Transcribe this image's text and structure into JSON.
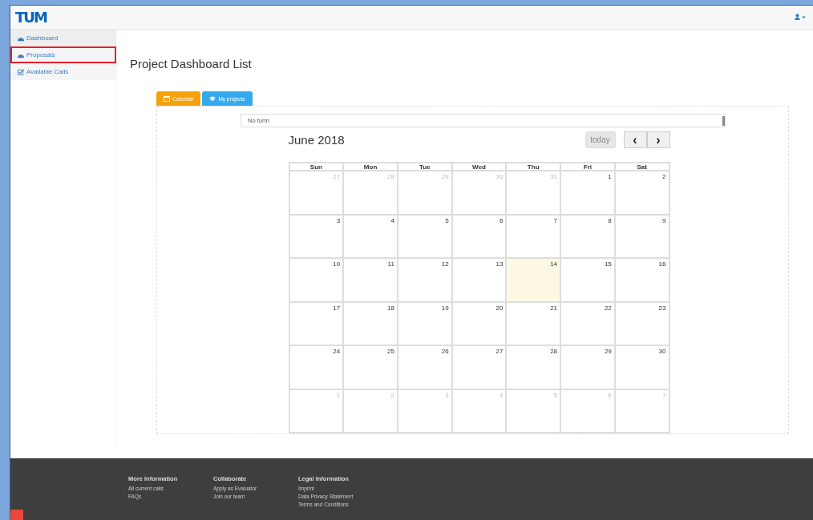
{
  "navbar": {
    "logo": "TUM"
  },
  "sidebar": {
    "items": [
      {
        "label": "Dashboard",
        "kind": "dashboard",
        "highlighted": false
      },
      {
        "label": "Proposals",
        "kind": "dashboard",
        "highlighted": true
      },
      {
        "label": "Available Calls",
        "kind": "check",
        "highlighted": false
      }
    ]
  },
  "page": {
    "title": "Project Dashboard List"
  },
  "tabs": [
    {
      "label": "Calendar",
      "kind": "calendar",
      "color": "#f5a20a"
    },
    {
      "label": "My projects",
      "kind": "cap",
      "color": "#33a9ee"
    }
  ],
  "form_select": {
    "value": "No form"
  },
  "calendar": {
    "title": "June 2018",
    "today_button": "today",
    "prev_button": "‹",
    "next_button": "›",
    "weekdays": [
      "Sun",
      "Mon",
      "Tue",
      "Wed",
      "Thu",
      "Fri",
      "Sat"
    ],
    "weeks": [
      [
        {
          "day": "27",
          "other_month": true,
          "today": false
        },
        {
          "day": "28",
          "other_month": true,
          "today": false
        },
        {
          "day": "29",
          "other_month": true,
          "today": false
        },
        {
          "day": "30",
          "other_month": true,
          "today": false
        },
        {
          "day": "31",
          "other_month": true,
          "today": false
        },
        {
          "day": "1",
          "other_month": false,
          "today": false
        },
        {
          "day": "2",
          "other_month": false,
          "today": false
        }
      ],
      [
        {
          "day": "3",
          "other_month": false,
          "today": false
        },
        {
          "day": "4",
          "other_month": false,
          "today": false
        },
        {
          "day": "5",
          "other_month": false,
          "today": false
        },
        {
          "day": "6",
          "other_month": false,
          "today": false
        },
        {
          "day": "7",
          "other_month": false,
          "today": false
        },
        {
          "day": "8",
          "other_month": false,
          "today": false
        },
        {
          "day": "9",
          "other_month": false,
          "today": false
        }
      ],
      [
        {
          "day": "10",
          "other_month": false,
          "today": false
        },
        {
          "day": "11",
          "other_month": false,
          "today": false
        },
        {
          "day": "12",
          "other_month": false,
          "today": false
        },
        {
          "day": "13",
          "other_month": false,
          "today": false
        },
        {
          "day": "14",
          "other_month": false,
          "today": true
        },
        {
          "day": "15",
          "other_month": false,
          "today": false
        },
        {
          "day": "16",
          "other_month": false,
          "today": false
        }
      ],
      [
        {
          "day": "17",
          "other_month": false,
          "today": false
        },
        {
          "day": "18",
          "other_month": false,
          "today": false
        },
        {
          "day": "19",
          "other_month": false,
          "today": false
        },
        {
          "day": "20",
          "other_month": false,
          "today": false
        },
        {
          "day": "21",
          "other_month": false,
          "today": false
        },
        {
          "day": "22",
          "other_month": false,
          "today": false
        },
        {
          "day": "23",
          "other_month": false,
          "today": false
        }
      ],
      [
        {
          "day": "24",
          "other_month": false,
          "today": false
        },
        {
          "day": "25",
          "other_month": false,
          "today": false
        },
        {
          "day": "26",
          "other_month": false,
          "today": false
        },
        {
          "day": "27",
          "other_month": false,
          "today": false
        },
        {
          "day": "28",
          "other_month": false,
          "today": false
        },
        {
          "day": "29",
          "other_month": false,
          "today": false
        },
        {
          "day": "30",
          "other_month": false,
          "today": false
        }
      ],
      [
        {
          "day": "1",
          "other_month": true,
          "today": false
        },
        {
          "day": "2",
          "other_month": true,
          "today": false
        },
        {
          "day": "3",
          "other_month": true,
          "today": false
        },
        {
          "day": "4",
          "other_month": true,
          "today": false
        },
        {
          "day": "5",
          "other_month": true,
          "today": false
        },
        {
          "day": "6",
          "other_month": true,
          "today": false
        },
        {
          "day": "7",
          "other_month": true,
          "today": false
        }
      ]
    ]
  },
  "footer": {
    "columns": [
      {
        "heading": "More Information",
        "links": [
          "All current calls",
          "FAQs"
        ]
      },
      {
        "heading": "Collaborate",
        "links": [
          "Apply as Evaluator",
          "Join our team"
        ]
      },
      {
        "heading": "Legal Information",
        "links": [
          "Imprint",
          "Data Privacy Statement",
          "Terms and Conditions"
        ]
      }
    ]
  }
}
